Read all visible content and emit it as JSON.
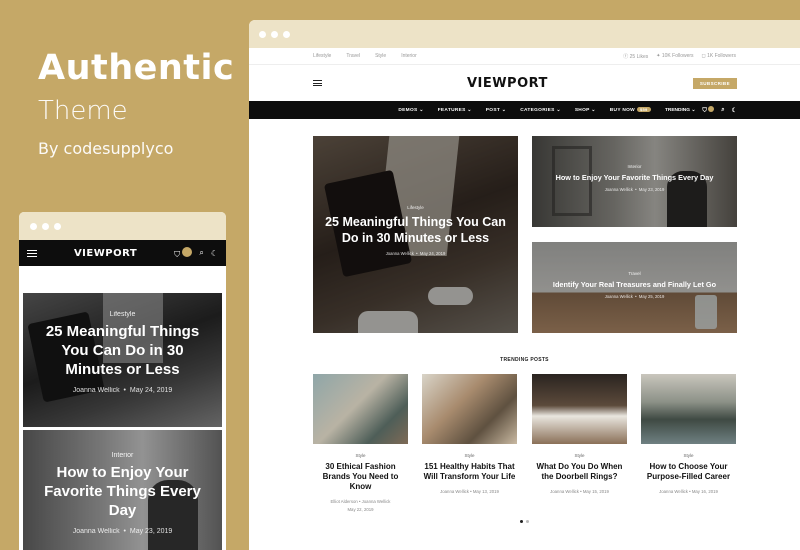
{
  "promo": {
    "title": "Authentic",
    "subtitle": "Theme",
    "byline": "By codesupplyco"
  },
  "desktop": {
    "topbar": {
      "links": [
        "Lifestyle",
        "Travel",
        "Style",
        "Interior"
      ],
      "social": [
        "25 Likes",
        "10K Followers",
        "1K Followers"
      ]
    },
    "logo": "VIEWPORT",
    "subscribe": "SUBSCRIBE",
    "nav": {
      "items": [
        "DEMOS",
        "FEATURES",
        "POST",
        "CATEGORIES",
        "SHOP"
      ],
      "buy": "BUY NOW",
      "price": "$59",
      "trending": "TRENDING",
      "cart_count": "0"
    },
    "hero": {
      "main": {
        "category": "Lifestyle",
        "title": "25 Meaningful Things You Can Do in 30 Minutes or Less",
        "author": "Joanna Wellick",
        "date": "May 24, 2019"
      },
      "side1": {
        "category": "Interior",
        "title": "How to Enjoy Your Favorite Things Every Day",
        "author": "Joanna Wellick",
        "date": "May 23, 2019"
      },
      "side2": {
        "category": "Travel",
        "title": "Identify Your Real Treasures and Finally Let Go",
        "author": "Joanna Wellick",
        "date": "May 25, 2019"
      }
    },
    "trending_label": "TRENDING POSTS",
    "trending_posts": [
      {
        "category": "Style",
        "title": "30 Ethical Fashion Brands You Need to Know",
        "meta1": "Elliot Alderson  •  Joanna Wellick",
        "meta2": "May 22, 2019"
      },
      {
        "category": "Style",
        "title": "151 Healthy Habits That Will Transform Your Life",
        "meta1": "Joanna Wellick  •  May 13, 2019",
        "meta2": ""
      },
      {
        "category": "Style",
        "title": "What Do You Do When the Doorbell Rings?",
        "meta1": "Joanna Wellick  •  May 15, 2019",
        "meta2": ""
      },
      {
        "category": "Style",
        "title": "How to Choose Your Purpose-Filled Career",
        "meta1": "Joanna Wellick  •  May 16, 2019",
        "meta2": ""
      }
    ]
  },
  "mobile": {
    "logo": "VIEWPORT",
    "cart_count": "0",
    "card1": {
      "category": "Lifestyle",
      "title": "25 Meaningful Things You Can Do in 30 Minutes or Less",
      "author": "Joanna Wellick",
      "date": "May 24, 2019"
    },
    "card2": {
      "category": "Interior",
      "title": "How to Enjoy Your Favorite Things Every Day",
      "author": "Joanna Wellick",
      "date": "May 23, 2019"
    }
  },
  "colors": {
    "gold": "#c5a867",
    "dark": "#0d0d0d"
  }
}
